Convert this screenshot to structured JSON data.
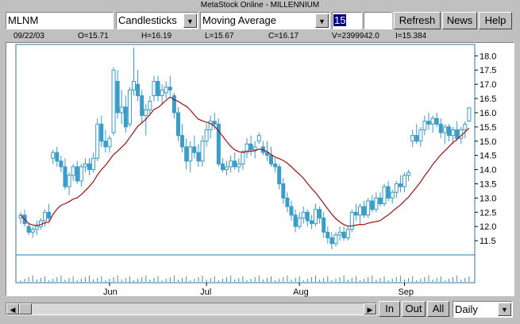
{
  "window": {
    "title": "MetaStock Online - MILLENNIUM"
  },
  "toolbar": {
    "symbol": "MLNM",
    "chart_type": "Candlesticks",
    "indicator": "Moving Average",
    "period": "15",
    "extra": "",
    "refresh_label": "Refresh",
    "news_label": "News",
    "help_label": "Help"
  },
  "info": {
    "date": "09/22/03",
    "open": "O=15.71",
    "high": "H=16.19",
    "low": "L=15.67",
    "close": "C=16.17",
    "volume": "V=2399942.0",
    "indicator": "I=15.384"
  },
  "bottom": {
    "in_label": "In",
    "out_label": "Out",
    "all_label": "All",
    "interval": "Daily"
  },
  "colors": {
    "candle": "#3a9cc8",
    "ma": "#a01010",
    "volume": "#4a8ab8",
    "axis_frame": "#2a7aa8"
  },
  "chart_data": {
    "type": "candlestick",
    "y_ticks": [
      "11.5",
      "12.0",
      "12.5",
      "13.0",
      "13.5",
      "14.0",
      "14.5",
      "15.0",
      "15.5",
      "16.0",
      "16.5",
      "17.0",
      "17.5",
      "18.0"
    ],
    "ylim": [
      11.0,
      18.4
    ],
    "x_ticks": [
      "Jun",
      "Jul",
      "Aug",
      "Sep"
    ],
    "candles": [
      [
        12.3,
        12.5,
        12.1,
        12.4
      ],
      [
        12.4,
        12.6,
        12.0,
        12.1
      ],
      [
        12.0,
        12.1,
        11.7,
        11.8
      ],
      [
        11.8,
        12.0,
        11.6,
        11.9
      ],
      [
        11.9,
        12.2,
        11.7,
        12.0
      ],
      [
        12.0,
        12.3,
        11.9,
        12.2
      ],
      [
        12.2,
        12.6,
        12.0,
        12.5
      ],
      [
        12.5,
        12.8,
        12.2,
        12.3
      ],
      [
        14.4,
        14.7,
        14.2,
        14.6
      ],
      [
        14.6,
        14.8,
        14.1,
        14.3
      ],
      [
        14.3,
        14.5,
        13.9,
        14.1
      ],
      [
        14.1,
        14.4,
        13.3,
        13.4
      ],
      [
        13.4,
        13.9,
        13.1,
        13.8
      ],
      [
        13.8,
        14.2,
        13.6,
        14.1
      ],
      [
        14.1,
        14.3,
        13.5,
        13.6
      ],
      [
        13.6,
        14.2,
        13.4,
        14.1
      ],
      [
        14.1,
        14.4,
        13.9,
        14.2
      ],
      [
        14.2,
        14.4,
        13.8,
        14.0
      ],
      [
        14.0,
        14.6,
        13.9,
        14.4
      ],
      [
        14.4,
        15.8,
        14.3,
        15.6
      ],
      [
        15.6,
        15.9,
        14.8,
        15.0
      ],
      [
        15.0,
        15.4,
        14.6,
        14.8
      ],
      [
        14.8,
        15.2,
        14.6,
        15.1
      ],
      [
        15.3,
        17.6,
        15.2,
        17.5
      ],
      [
        17.1,
        17.5,
        15.8,
        16.0
      ],
      [
        16.0,
        16.8,
        15.6,
        16.2
      ],
      [
        16.2,
        16.6,
        15.3,
        15.5
      ],
      [
        15.6,
        16.9,
        15.5,
        16.8
      ],
      [
        16.8,
        18.3,
        16.6,
        17.1
      ],
      [
        17.0,
        17.5,
        16.4,
        16.6
      ],
      [
        16.6,
        16.8,
        15.6,
        15.9
      ],
      [
        15.9,
        16.3,
        15.2,
        16.1
      ],
      [
        16.1,
        16.6,
        15.9,
        16.4
      ],
      [
        16.6,
        17.3,
        16.4,
        17.1
      ],
      [
        17.1,
        17.3,
        16.4,
        16.6
      ],
      [
        16.6,
        17.0,
        16.3,
        16.8
      ],
      [
        16.7,
        17.1,
        16.5,
        16.9
      ],
      [
        16.9,
        17.3,
        16.6,
        16.8
      ],
      [
        16.6,
        16.7,
        15.8,
        16.0
      ],
      [
        16.0,
        16.2,
        15.0,
        15.2
      ],
      [
        15.2,
        15.6,
        14.6,
        14.8
      ],
      [
        14.8,
        15.1,
        14.0,
        14.3
      ],
      [
        14.3,
        15.0,
        13.9,
        14.8
      ],
      [
        14.8,
        15.2,
        14.4,
        14.6
      ],
      [
        14.6,
        14.9,
        14.1,
        14.3
      ],
      [
        14.3,
        15.2,
        14.1,
        15.0
      ],
      [
        15.0,
        15.6,
        14.8,
        15.4
      ],
      [
        15.4,
        15.9,
        15.1,
        15.7
      ],
      [
        15.7,
        16.0,
        15.4,
        15.6
      ],
      [
        15.6,
        15.8,
        14.1,
        14.2
      ],
      [
        14.2,
        14.4,
        13.9,
        14.0
      ],
      [
        14.0,
        14.3,
        13.8,
        14.1
      ],
      [
        14.1,
        14.5,
        13.9,
        14.3
      ],
      [
        14.3,
        14.6,
        14.0,
        14.1
      ],
      [
        14.1,
        14.4,
        13.9,
        14.2
      ],
      [
        14.2,
        14.7,
        14.0,
        14.6
      ],
      [
        14.6,
        15.1,
        14.4,
        14.9
      ],
      [
        14.9,
        15.2,
        14.5,
        14.7
      ],
      [
        14.7,
        15.0,
        14.4,
        14.8
      ],
      [
        15.0,
        15.3,
        14.9,
        15.2
      ],
      [
        14.8,
        15.0,
        14.5,
        14.6
      ],
      [
        14.6,
        15.0,
        14.3,
        14.5
      ],
      [
        14.5,
        14.8,
        14.1,
        14.2
      ],
      [
        14.2,
        14.4,
        13.9,
        14.1
      ],
      [
        14.1,
        14.2,
        13.3,
        13.5
      ],
      [
        13.5,
        13.7,
        12.8,
        13.0
      ],
      [
        13.0,
        13.2,
        12.5,
        12.7
      ],
      [
        12.7,
        12.9,
        12.2,
        12.4
      ],
      [
        12.4,
        12.6,
        11.8,
        12.0
      ],
      [
        12.0,
        12.5,
        11.9,
        12.3
      ],
      [
        12.3,
        12.7,
        12.1,
        12.5
      ],
      [
        12.5,
        12.6,
        12.0,
        12.2
      ],
      [
        12.2,
        12.4,
        11.9,
        12.1
      ],
      [
        12.1,
        12.8,
        12.0,
        12.6
      ],
      [
        12.6,
        12.7,
        12.1,
        12.3
      ],
      [
        12.3,
        12.5,
        11.6,
        11.8
      ],
      [
        11.8,
        12.0,
        11.4,
        11.6
      ],
      [
        11.6,
        11.8,
        11.2,
        11.4
      ],
      [
        11.4,
        11.8,
        11.3,
        11.7
      ],
      [
        11.7,
        12.0,
        11.5,
        11.8
      ],
      [
        11.8,
        12.0,
        11.5,
        11.6
      ],
      [
        11.6,
        12.0,
        11.5,
        11.9
      ],
      [
        11.9,
        12.6,
        11.8,
        12.5
      ],
      [
        12.5,
        12.8,
        12.2,
        12.4
      ],
      [
        12.4,
        12.8,
        12.1,
        12.7
      ],
      [
        12.7,
        12.9,
        12.3,
        12.4
      ],
      [
        12.4,
        13.0,
        12.3,
        12.9
      ],
      [
        12.9,
        13.1,
        12.5,
        12.6
      ],
      [
        12.6,
        13.2,
        12.5,
        13.0
      ],
      [
        13.0,
        13.2,
        12.7,
        12.8
      ],
      [
        12.8,
        13.5,
        12.7,
        13.4
      ],
      [
        13.4,
        13.6,
        12.9,
        13.0
      ],
      [
        13.0,
        13.3,
        12.8,
        13.2
      ],
      [
        13.2,
        13.6,
        13.0,
        13.5
      ],
      [
        13.5,
        13.8,
        13.2,
        13.4
      ],
      [
        13.4,
        13.9,
        13.2,
        13.8
      ],
      [
        13.8,
        14.0,
        13.6,
        13.9
      ],
      [
        15.0,
        15.4,
        14.8,
        15.2
      ],
      [
        15.2,
        15.6,
        14.9,
        15.0
      ],
      [
        15.0,
        15.5,
        14.8,
        15.4
      ],
      [
        15.4,
        15.9,
        15.2,
        15.7
      ],
      [
        15.7,
        16.0,
        15.4,
        15.6
      ],
      [
        15.6,
        15.9,
        15.3,
        15.8
      ],
      [
        15.8,
        16.0,
        15.5,
        15.6
      ],
      [
        15.6,
        15.8,
        15.1,
        15.3
      ],
      [
        15.3,
        15.6,
        14.9,
        15.5
      ],
      [
        15.5,
        15.6,
        15.0,
        15.2
      ],
      [
        15.2,
        15.5,
        14.9,
        15.4
      ],
      [
        15.4,
        15.7,
        15.0,
        15.1
      ],
      [
        15.1,
        15.5,
        14.9,
        15.4
      ],
      [
        15.4,
        15.7,
        15.1,
        15.6
      ],
      [
        15.71,
        16.19,
        15.67,
        16.17
      ]
    ]
  }
}
